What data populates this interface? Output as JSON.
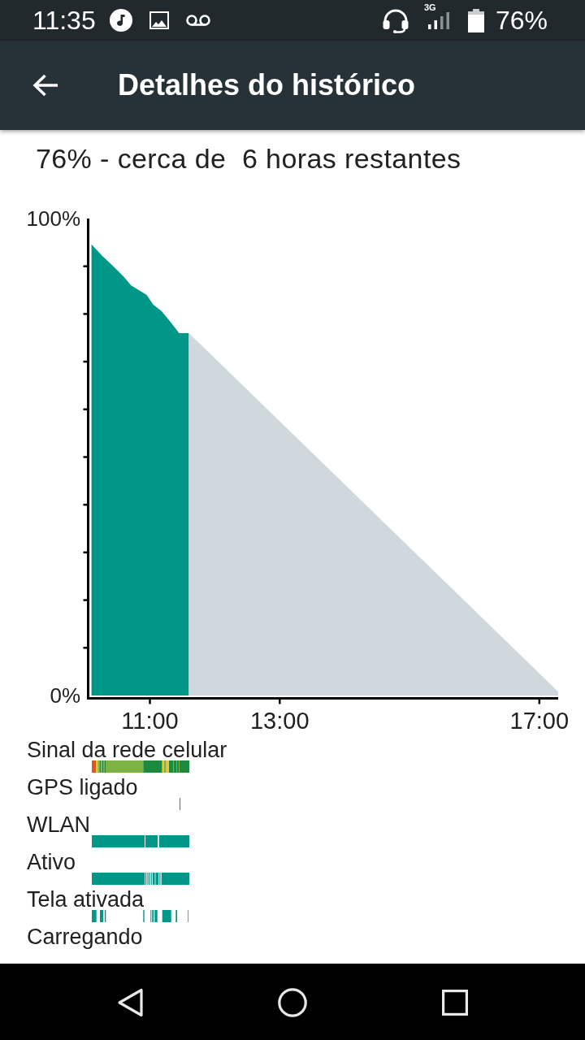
{
  "status_bar": {
    "time": "11:35",
    "network_type": "3G",
    "battery": "76%"
  },
  "toolbar": {
    "title": "Detalhes do histórico"
  },
  "battery": {
    "summary": "76% - cerca de  6 horas restantes",
    "chart_data": {
      "type": "area",
      "x": [
        10.1,
        10.27,
        10.42,
        10.59,
        10.71,
        10.95,
        11.05,
        11.18,
        11.3,
        11.45,
        11.6,
        17.29
      ],
      "series": [
        {
          "color": "#009688",
          "values": [
            94.6,
            92.1,
            90.2,
            87.9,
            86,
            84,
            82,
            80.6,
            78.6,
            76,
            76,
            null
          ]
        },
        {
          "color": "#cfd8dc",
          "values": [
            null,
            null,
            null,
            null,
            null,
            null,
            null,
            null,
            null,
            null,
            76,
            0.8
          ]
        }
      ],
      "xlim": [
        10.03,
        17.29
      ],
      "ylim": [
        0,
        100
      ],
      "xticks": [
        {
          "value": 11,
          "label": "11:00"
        },
        {
          "value": 13,
          "label": "13:00"
        },
        {
          "value": 17,
          "label": "17:00"
        }
      ],
      "yticks": [
        {
          "value": 0,
          "label": "0%"
        },
        {
          "value": 100,
          "label": "100%"
        }
      ]
    }
  },
  "timeline": [
    {
      "kind": "signal",
      "label": "Sinal da rede celular"
    },
    {
      "kind": "gps",
      "label": "GPS ligado"
    },
    {
      "kind": "wlan",
      "label": "WLAN"
    },
    {
      "kind": "awake",
      "label": "Ativo"
    },
    {
      "kind": "screen",
      "label": "Tela ativada"
    },
    {
      "kind": "charging",
      "label": "Carregando"
    }
  ]
}
